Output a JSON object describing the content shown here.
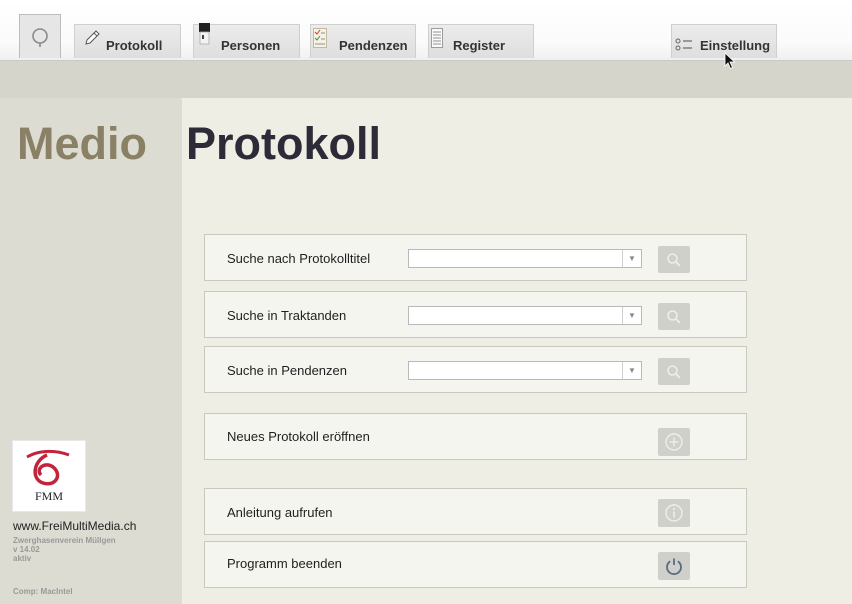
{
  "tabs": {
    "protokoll": "Protokoll",
    "personen": "Personen",
    "pendenzen": "Pendenzen",
    "register": "Register",
    "einstellung": "Einstellung"
  },
  "brand": {
    "first": "Medio",
    "second": "Protokoll"
  },
  "search": [
    {
      "label": "Suche nach Protokolltitel",
      "value": "",
      "arrow": "▼"
    },
    {
      "label": "Suche in Traktanden",
      "value": "",
      "arrow": "▼"
    },
    {
      "label": "Suche in Pendenzen",
      "value": "",
      "arrow": "▼"
    }
  ],
  "actions": {
    "new_protokoll": "Neues Protokoll eröffnen",
    "anleitung": "Anleitung aufrufen",
    "beenden": "Programm beenden"
  },
  "sidebar": {
    "logo_text": "FMM",
    "website": "www.FreiMultiMedia.ch",
    "org": "Zwerghasenverein Müllgen",
    "version": "v 14.02",
    "status": "aktiv",
    "comp": "Comp:  MacIntel"
  },
  "colors": {
    "brand_medio": "#8a8066",
    "brand_protokoll": "#2e2b38",
    "logo_red": "#c4243a"
  }
}
